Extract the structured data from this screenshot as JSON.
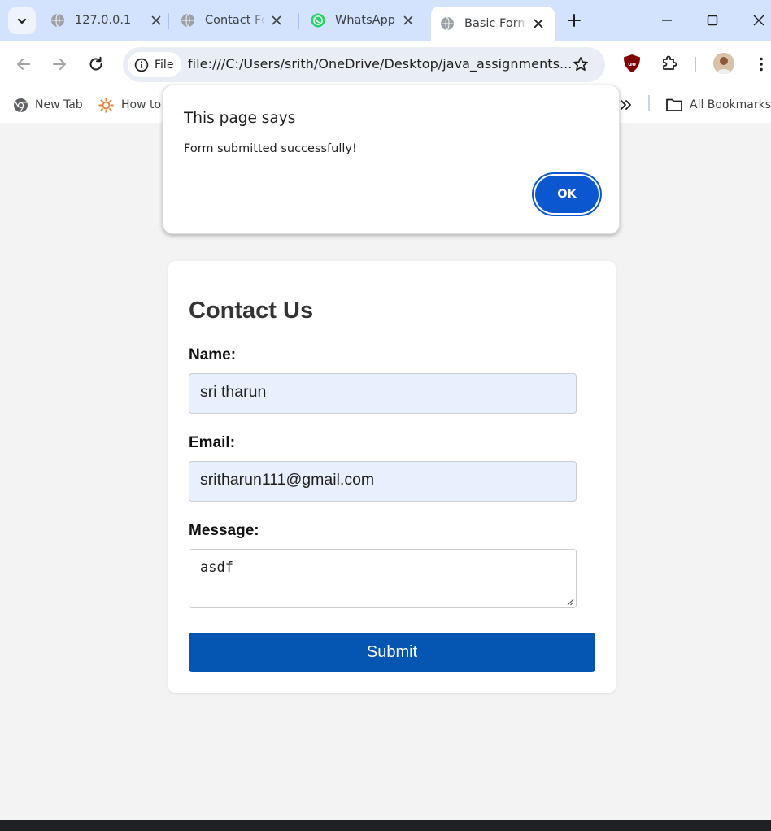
{
  "browser": {
    "tabs": [
      {
        "title": "127.0.0.1",
        "active": false,
        "icon": "globe-icon"
      },
      {
        "title": "Contact Form",
        "active": false,
        "icon": "globe-icon"
      },
      {
        "title": "WhatsApp",
        "active": false,
        "icon": "whatsapp-icon"
      },
      {
        "title": "Basic Form",
        "active": true,
        "icon": "globe-icon"
      }
    ],
    "omnibox": {
      "chip_label": "File",
      "url": "file:///C:/Users/srith/OneDrive/Desktop/java_assignments..."
    },
    "bookmarks": [
      {
        "label": "New Tab",
        "icon": "chrome-icon"
      },
      {
        "label": "How to",
        "icon": "bookmark-favicon"
      }
    ],
    "all_bookmarks_label": "All Bookmarks",
    "colors": {
      "tabstrip": "#d3e3fd",
      "omnibox": "#e9eef6",
      "accent": "#0b57d0"
    }
  },
  "dialog": {
    "title": "This page says",
    "message": "Form submitted successfully!",
    "ok_label": "OK"
  },
  "form": {
    "heading": "Contact Us",
    "name_label": "Name:",
    "name_value": "sri tharun",
    "email_label": "Email:",
    "email_value": "sritharun111@gmail.com",
    "message_label": "Message:",
    "message_value": "asdf",
    "submit_label": "Submit",
    "submit_color": "#0556b3"
  }
}
